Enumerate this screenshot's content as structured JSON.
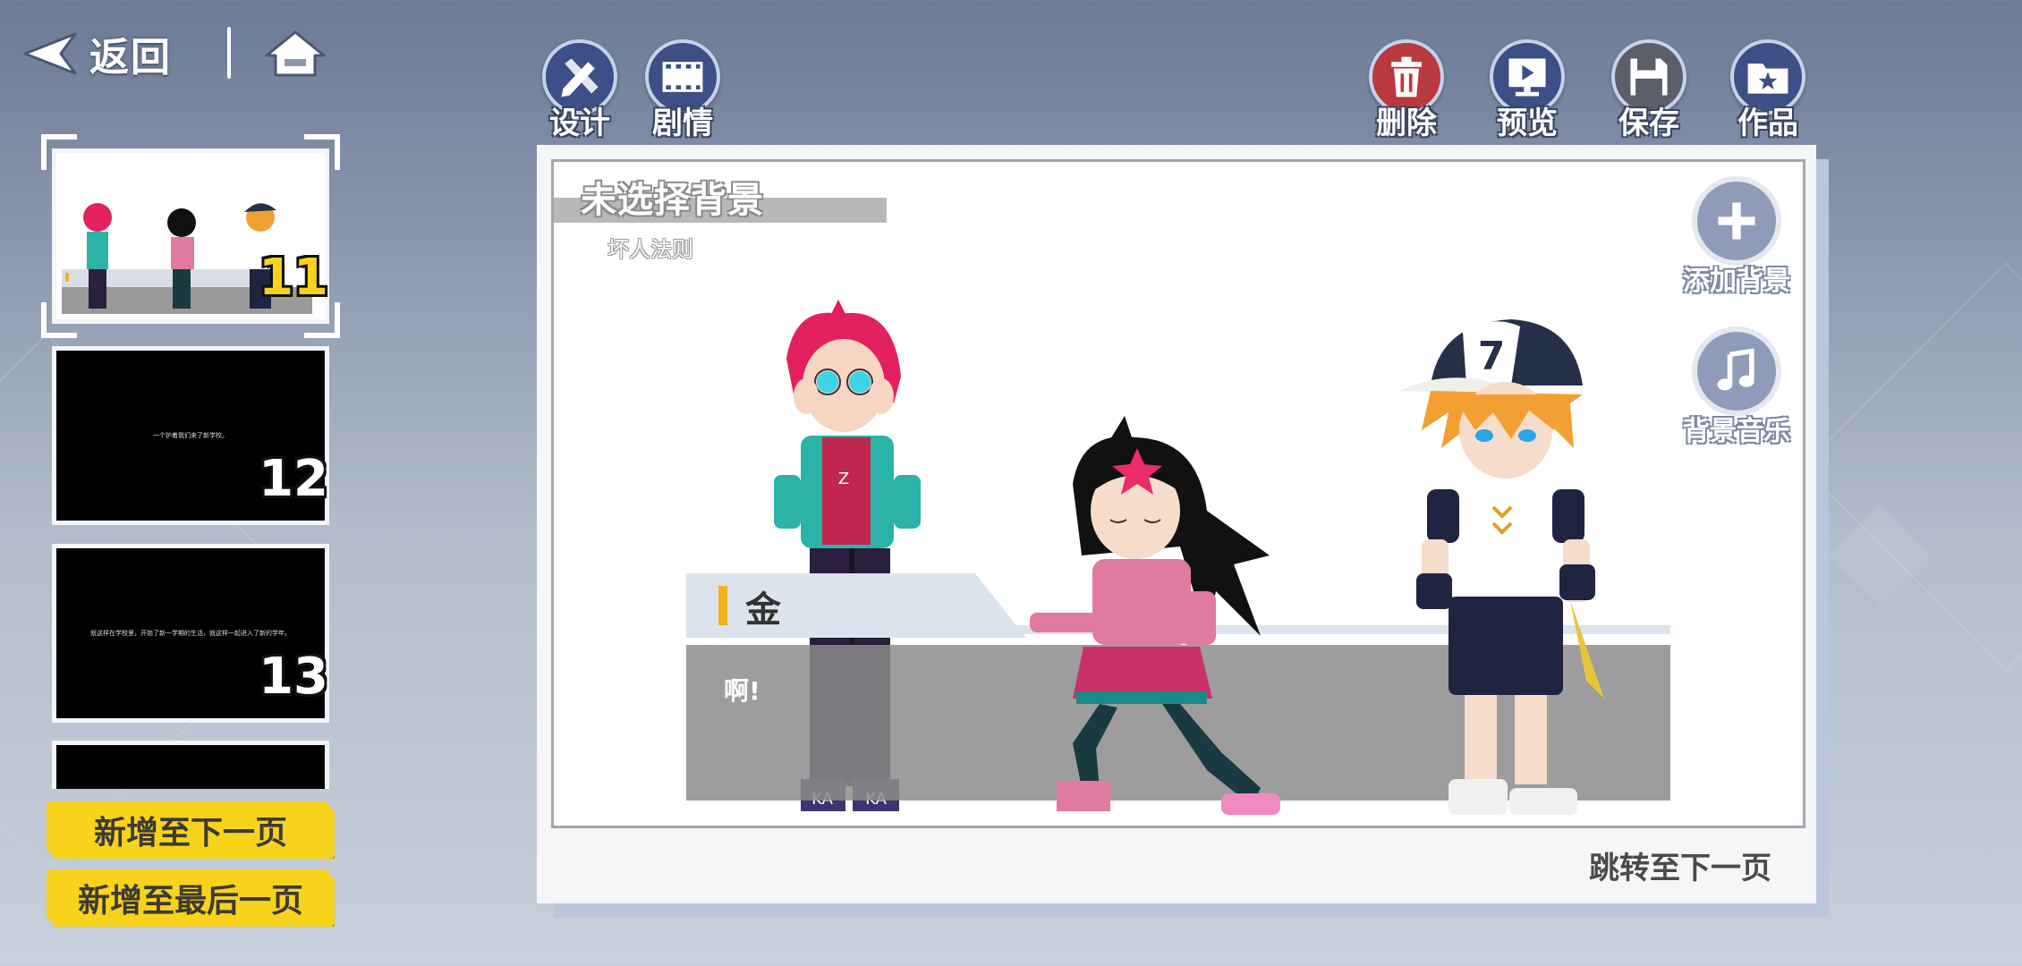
{
  "nav": {
    "back_label": "返回"
  },
  "tools": {
    "design": "设计",
    "story": "剧情",
    "delete": "删除",
    "preview": "预览",
    "save": "保存",
    "works": "作品"
  },
  "colors": {
    "accent_yellow": "#f7d31c",
    "tool_blue": "#3e4f87",
    "delete_red": "#b83a3e",
    "dialog_gray": "#8c8c8c"
  },
  "pages": [
    {
      "number": "11",
      "preview_name": "金",
      "selected": true
    },
    {
      "number": "12",
      "text": "一个护着我们来了新学校。"
    },
    {
      "number": "13",
      "text": "就这样在学校里，开始了新一学期的生活，就这样一起进入了新的学年。"
    }
  ],
  "sidebar_buttons": {
    "add_next": "新增至下一页",
    "add_last": "新增至最后一页"
  },
  "scene": {
    "background_title": "未选择背景",
    "background_subtitle": "坏人法则",
    "add_background": "添加背景",
    "background_music": "背景音乐",
    "speaker": "金",
    "dialog": "啊!",
    "next_page": "跳转至下一页",
    "shoe_text": "KA",
    "cap_number": "7"
  }
}
